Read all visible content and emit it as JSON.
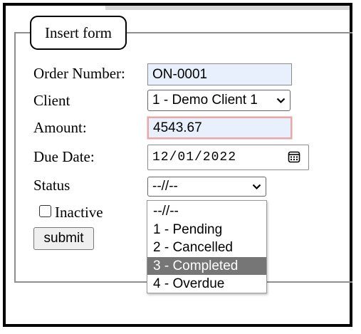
{
  "form": {
    "legend": "Insert form",
    "order_number": {
      "label": "Order Number:",
      "value": "ON-0001"
    },
    "client": {
      "label": "Client",
      "selected": "1 - Demo Client 1"
    },
    "amount": {
      "label": "Amount:",
      "value": "4543.67"
    },
    "due_date": {
      "label": "Due Date:",
      "value": "12/01/2022"
    },
    "status": {
      "label": "Status",
      "selected": "--//--",
      "options": [
        "--//--",
        "1 - Pending",
        "2 - Cancelled",
        "3 - Completed",
        "4 - Overdue"
      ],
      "highlighted": "3 - Completed"
    },
    "inactive": {
      "label": "Inactive",
      "checked": false
    },
    "submit_label": "submit"
  },
  "icons": {
    "calendar": "calendar-icon",
    "dropdown": "chevron-down-icon"
  },
  "colors": {
    "autofill_bg": "#e8f0fe",
    "invalid_border": "#e8a7a7",
    "option_highlight": "#767676"
  }
}
